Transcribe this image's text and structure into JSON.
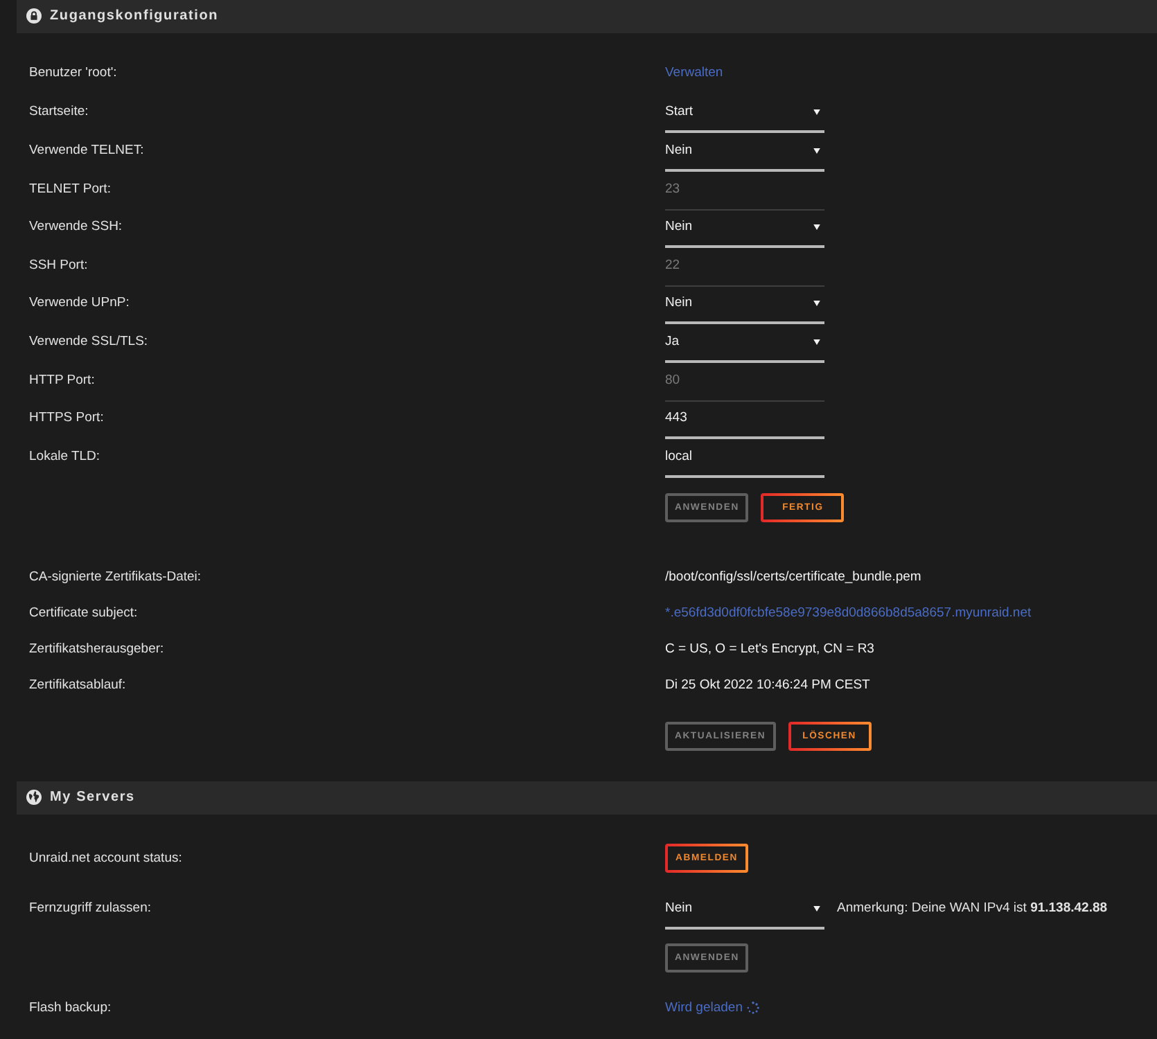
{
  "sections": [
    {
      "title": "Zugangskonfiguration",
      "groups": [
        {
          "rows": [
            {
              "label": "Benutzer 'root':",
              "kind": "link",
              "value": "Verwalten"
            },
            {
              "label": "Startseite:",
              "kind": "select",
              "value": "Start"
            },
            {
              "label": "Verwende TELNET:",
              "kind": "select",
              "value": "Nein"
            },
            {
              "label": "TELNET Port:",
              "kind": "input",
              "value": "23",
              "disabled": true
            },
            {
              "label": "Verwende SSH:",
              "kind": "select",
              "value": "Nein"
            },
            {
              "label": "SSH Port:",
              "kind": "input",
              "value": "22",
              "disabled": true
            },
            {
              "label": "Verwende UPnP:",
              "kind": "select",
              "value": "Nein"
            },
            {
              "label": "Verwende SSL/TLS:",
              "kind": "select",
              "value": "Ja"
            },
            {
              "label": "HTTP Port:",
              "kind": "input",
              "value": "80",
              "disabled": true
            },
            {
              "label": "HTTPS Port:",
              "kind": "input",
              "value": "443",
              "disabled": false
            },
            {
              "label": "Lokale TLD:",
              "kind": "input",
              "value": "local",
              "disabled": false
            },
            {
              "kind": "buttons",
              "buttons": [
                {
                  "label": "ANWENDEN",
                  "disabled": true
                },
                {
                  "label": "FERTIG",
                  "disabled": false
                }
              ]
            }
          ]
        },
        {
          "rows": [
            {
              "label": "CA-signierte Zertifikats-Datei:",
              "kind": "text",
              "value": "/boot/config/ssl/certs/certificate_bundle.pem"
            },
            {
              "label": "Certificate subject:",
              "kind": "link",
              "value": "*.e56fd3d0df0fcbfe58e9739e8d0d866b8d5a8657.myunraid.net"
            },
            {
              "label": "Zertifikatsherausgeber:",
              "kind": "text",
              "value": "C = US, O = Let's Encrypt, CN = R3"
            },
            {
              "label": "Zertifikatsablauf:",
              "kind": "text",
              "value": "Di 25 Okt 2022 10:46:24 PM CEST"
            },
            {
              "kind": "buttons",
              "buttons": [
                {
                  "label": "AKTUALISIEREN",
                  "disabled": true
                },
                {
                  "label": "LÖSCHEN",
                  "disabled": false
                }
              ]
            }
          ]
        }
      ]
    },
    {
      "title": "My Servers",
      "groups": [
        {
          "rows": [
            {
              "label": "Unraid.net account status:",
              "kind": "buttons",
              "buttons": [
                {
                  "label": "ABMELDEN",
                  "disabled": false
                }
              ]
            },
            {
              "label": "Fernzugriff zulassen:",
              "kind": "select",
              "value": "Nein",
              "note": "Anmerkung: Deine WAN IPv4 ist **91.138.42.88**"
            },
            {
              "kind": "buttons",
              "buttons": [
                {
                  "label": "ANWENDEN",
                  "disabled": true
                }
              ]
            },
            {
              "label": "Flash backup:",
              "kind": "loading",
              "value": "Wird geladen"
            }
          ]
        }
      ]
    }
  ]
}
